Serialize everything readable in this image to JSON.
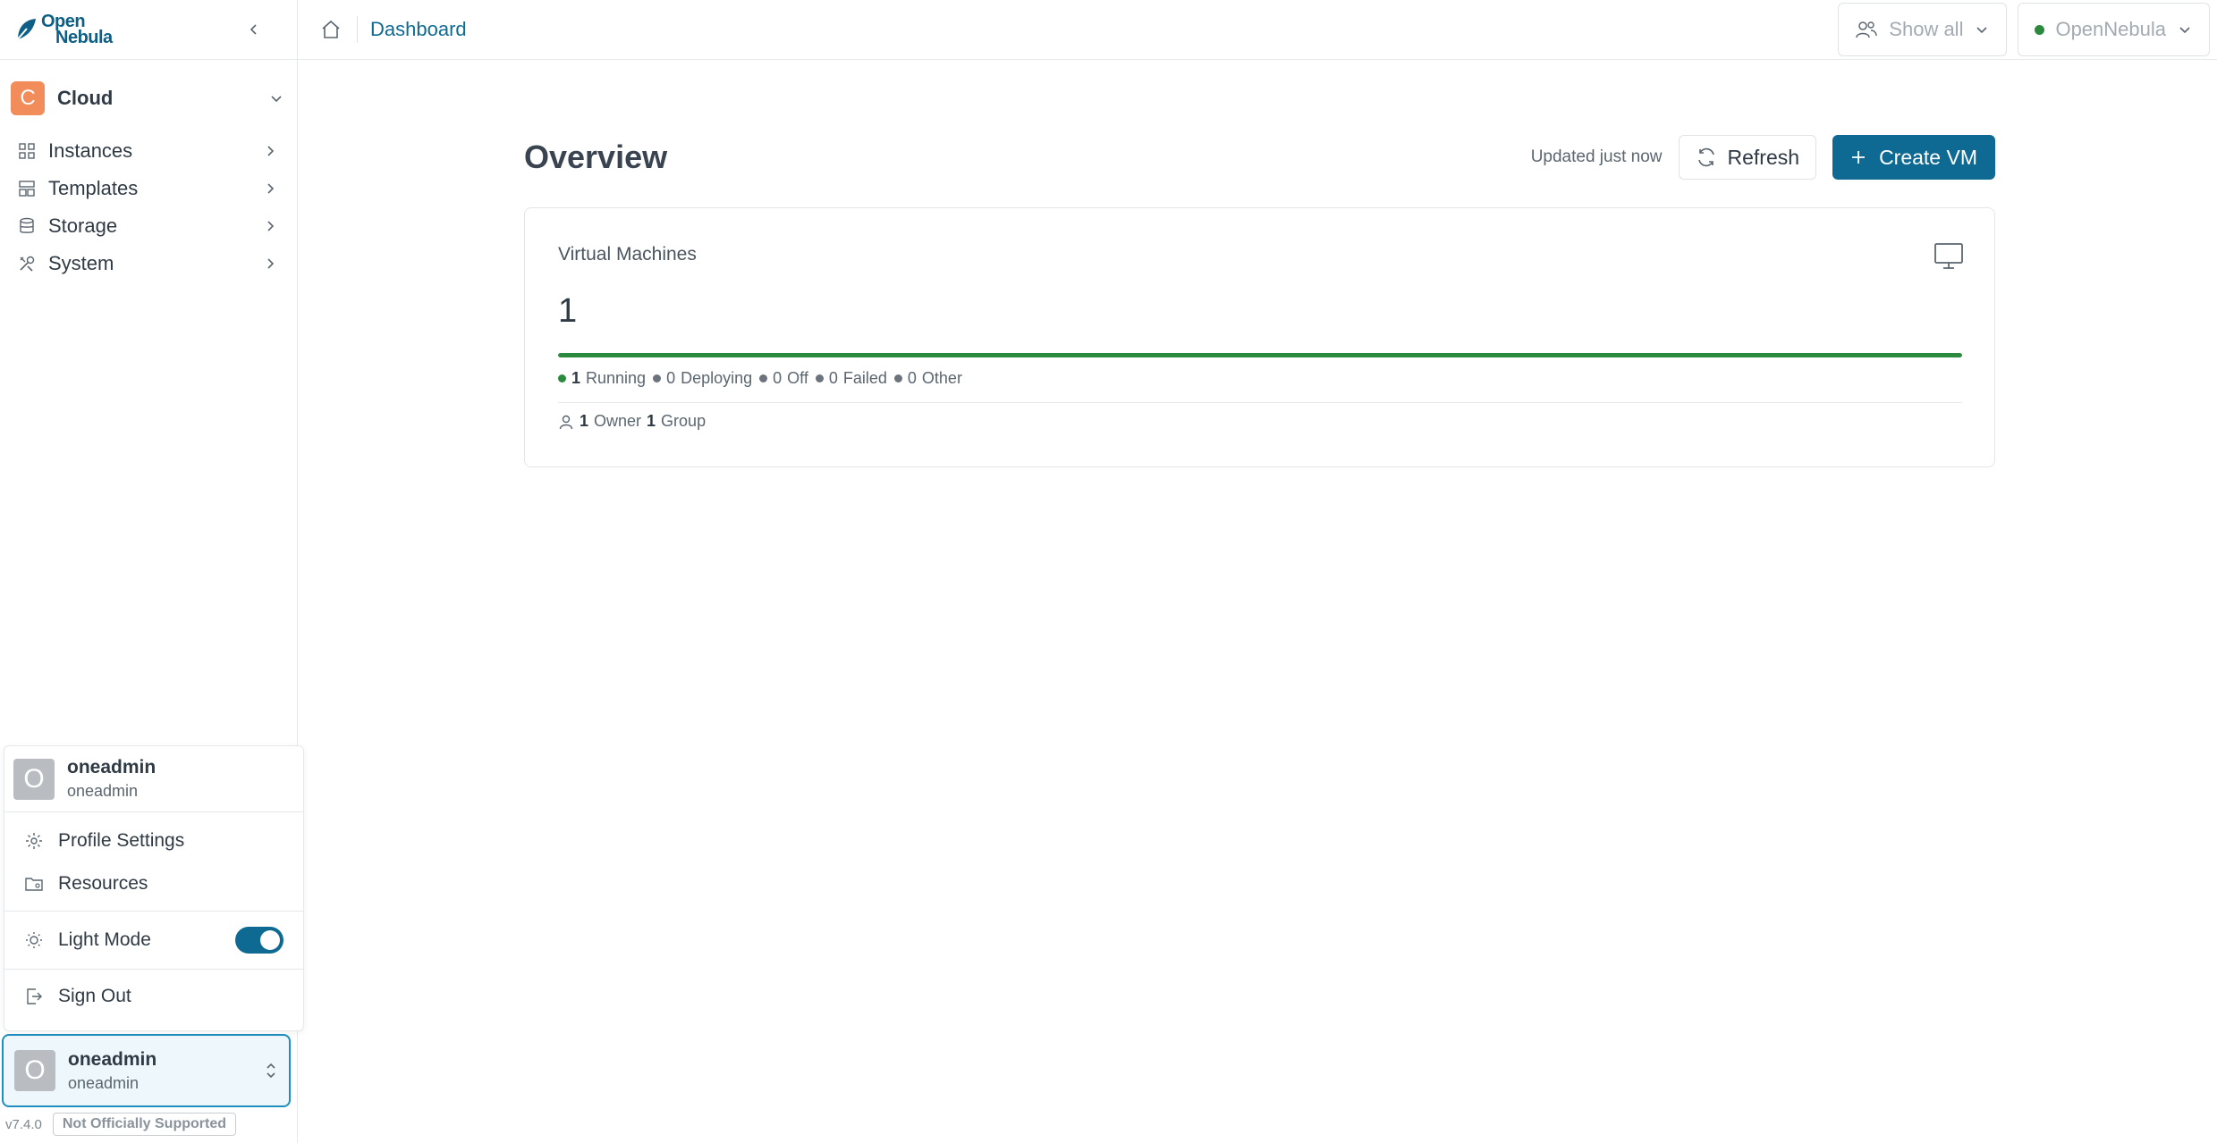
{
  "brand": {
    "line1": "Open",
    "line2": "Nebula"
  },
  "sidebar": {
    "cloud": {
      "badge": "C",
      "label": "Cloud",
      "badge_color": "#f28c5b"
    },
    "items": [
      {
        "label": "Instances",
        "icon": "grid-icon"
      },
      {
        "label": "Templates",
        "icon": "layout-icon"
      },
      {
        "label": "Storage",
        "icon": "database-icon"
      },
      {
        "label": "System",
        "icon": "tools-icon"
      }
    ]
  },
  "user_menu": {
    "avatar": "O",
    "name": "oneadmin",
    "username": "oneadmin",
    "profile_settings": "Profile Settings",
    "resources": "Resources",
    "light_mode": "Light Mode",
    "light_mode_on": true,
    "sign_out": "Sign Out"
  },
  "user_card": {
    "avatar": "O",
    "name": "oneadmin",
    "username": "oneadmin"
  },
  "footer": {
    "version": "v7.4.0",
    "badge": "Not Officially Supported"
  },
  "topbar": {
    "breadcrumb": "Dashboard",
    "group_filter": "Show all",
    "zone": "OpenNebula",
    "zone_status_color": "#2b8a3e"
  },
  "main": {
    "title": "Overview",
    "updated": "Updated just now",
    "refresh_label": "Refresh",
    "create_label": "Create VM",
    "accent": "#0e6a92"
  },
  "vm_card": {
    "title": "Virtual Machines",
    "count": "1",
    "running_fraction": 1.0,
    "states": [
      {
        "count": "1",
        "label": "Running"
      },
      {
        "count": "0",
        "label": "Deploying"
      },
      {
        "count": "0",
        "label": "Off"
      },
      {
        "count": "0",
        "label": "Failed"
      },
      {
        "count": "0",
        "label": "Other"
      }
    ],
    "owners": {
      "count": "1",
      "owner_label": "Owner",
      "group_count": "1",
      "group_label": "Group"
    }
  }
}
